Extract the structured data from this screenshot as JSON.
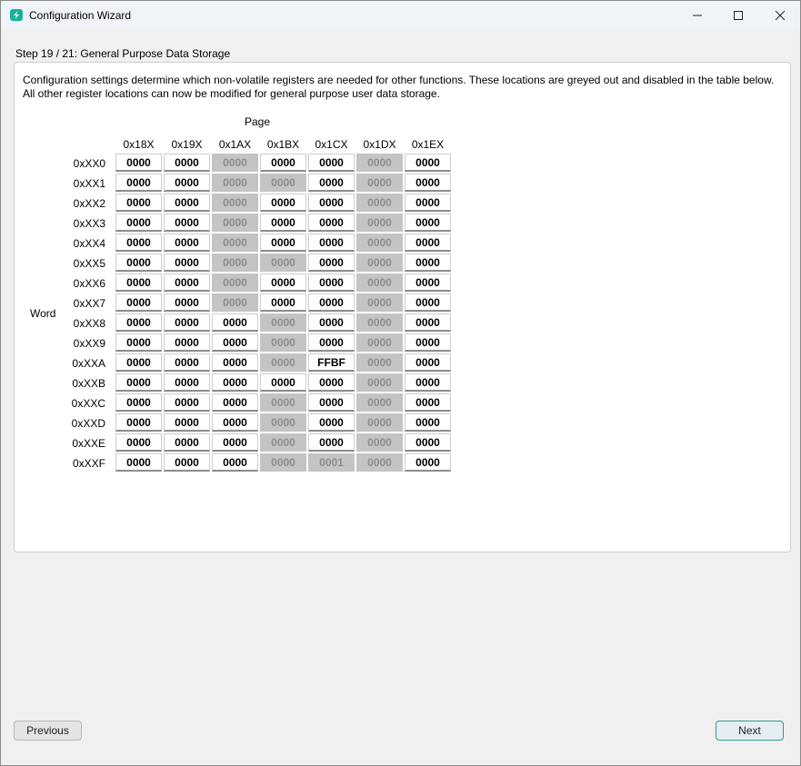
{
  "window": {
    "title": "Configuration Wizard"
  },
  "step": {
    "label": "Step 19 / 21: General Purpose Data Storage",
    "description": "Configuration settings determine which non-volatile registers are needed for other functions. These locations are greyed out and disabled in the table below. All other register locations can now be modified for general purpose user data storage."
  },
  "table": {
    "page_heading": "Page",
    "word_heading": "Word",
    "columns": [
      "0x18X",
      "0x19X",
      "0x1AX",
      "0x1BX",
      "0x1CX",
      "0x1DX",
      "0x1EX"
    ],
    "rows": [
      "0xXX0",
      "0xXX1",
      "0xXX2",
      "0xXX3",
      "0xXX4",
      "0xXX5",
      "0xXX6",
      "0xXX7",
      "0xXX8",
      "0xXX9",
      "0xXXA",
      "0xXXB",
      "0xXXC",
      "0xXXD",
      "0xXXE",
      "0xXXF"
    ],
    "values": [
      [
        "0000",
        "0000",
        "0000",
        "0000",
        "0000",
        "0000",
        "0000"
      ],
      [
        "0000",
        "0000",
        "0000",
        "0000",
        "0000",
        "0000",
        "0000"
      ],
      [
        "0000",
        "0000",
        "0000",
        "0000",
        "0000",
        "0000",
        "0000"
      ],
      [
        "0000",
        "0000",
        "0000",
        "0000",
        "0000",
        "0000",
        "0000"
      ],
      [
        "0000",
        "0000",
        "0000",
        "0000",
        "0000",
        "0000",
        "0000"
      ],
      [
        "0000",
        "0000",
        "0000",
        "0000",
        "0000",
        "0000",
        "0000"
      ],
      [
        "0000",
        "0000",
        "0000",
        "0000",
        "0000",
        "0000",
        "0000"
      ],
      [
        "0000",
        "0000",
        "0000",
        "0000",
        "0000",
        "0000",
        "0000"
      ],
      [
        "0000",
        "0000",
        "0000",
        "0000",
        "0000",
        "0000",
        "0000"
      ],
      [
        "0000",
        "0000",
        "0000",
        "0000",
        "0000",
        "0000",
        "0000"
      ],
      [
        "0000",
        "0000",
        "0000",
        "0000",
        "FFBF",
        "0000",
        "0000"
      ],
      [
        "0000",
        "0000",
        "0000",
        "0000",
        "0000",
        "0000",
        "0000"
      ],
      [
        "0000",
        "0000",
        "0000",
        "0000",
        "0000",
        "0000",
        "0000"
      ],
      [
        "0000",
        "0000",
        "0000",
        "0000",
        "0000",
        "0000",
        "0000"
      ],
      [
        "0000",
        "0000",
        "0000",
        "0000",
        "0000",
        "0000",
        "0000"
      ],
      [
        "0000",
        "0000",
        "0000",
        "0000",
        "0001",
        "0000",
        "0000"
      ]
    ],
    "disabled": [
      [
        false,
        false,
        true,
        false,
        false,
        true,
        false
      ],
      [
        false,
        false,
        true,
        true,
        false,
        true,
        false
      ],
      [
        false,
        false,
        true,
        false,
        false,
        true,
        false
      ],
      [
        false,
        false,
        true,
        false,
        false,
        true,
        false
      ],
      [
        false,
        false,
        true,
        false,
        false,
        true,
        false
      ],
      [
        false,
        false,
        true,
        true,
        false,
        true,
        false
      ],
      [
        false,
        false,
        true,
        false,
        false,
        true,
        false
      ],
      [
        false,
        false,
        true,
        false,
        false,
        true,
        false
      ],
      [
        false,
        false,
        false,
        true,
        false,
        true,
        false
      ],
      [
        false,
        false,
        false,
        true,
        false,
        true,
        false
      ],
      [
        false,
        false,
        false,
        true,
        false,
        true,
        false
      ],
      [
        false,
        false,
        false,
        false,
        false,
        true,
        false
      ],
      [
        false,
        false,
        false,
        true,
        false,
        true,
        false
      ],
      [
        false,
        false,
        false,
        true,
        false,
        true,
        false
      ],
      [
        false,
        false,
        false,
        true,
        false,
        true,
        false
      ],
      [
        false,
        false,
        false,
        true,
        true,
        true,
        false
      ]
    ]
  },
  "buttons": {
    "previous": "Previous",
    "next": "Next"
  },
  "icons": {
    "app": "app-logo-icon",
    "minimize": "minimize-icon",
    "maximize": "maximize-icon",
    "close": "close-icon"
  },
  "colors": {
    "accent": "#17b39a",
    "disabled_cell": "#c4c4c4",
    "next_border": "#2f9c8a"
  }
}
